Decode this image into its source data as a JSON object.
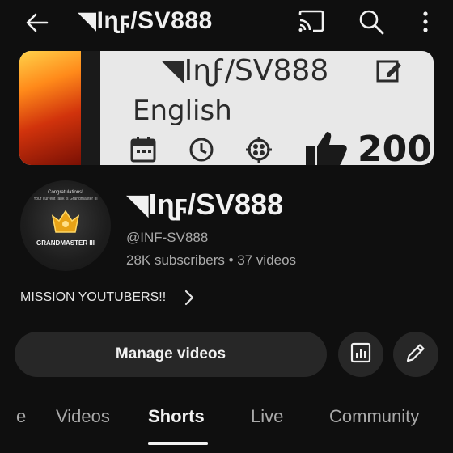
{
  "header": {
    "channel_title": "◥Iɳϝ/SV888",
    "icons": [
      "back-arrow-icon",
      "cast-icon",
      "search-icon",
      "more-vert-icon"
    ]
  },
  "banner": {
    "title": "◥Iɳϝ/SV888",
    "language": "English",
    "count": "200"
  },
  "avatar": {
    "line1": "Congratulations!",
    "line2": "Your current rank is Grandmaster III",
    "rank": "GRANDMASTER III"
  },
  "channel": {
    "name": "◥Iɳϝ/SV888",
    "handle": "@INF-SV888",
    "meta": "28K subscribers • 37 videos"
  },
  "link": {
    "text": "MISSION YOUTUBERS!!"
  },
  "actions": {
    "manage_label": "Manage videos"
  },
  "tabs": {
    "fragment": "e",
    "items": [
      "Videos",
      "Shorts",
      "Live",
      "Community"
    ],
    "active": "Shorts"
  },
  "colors": {
    "background": "#0f0f0f",
    "button": "#272727",
    "text_primary": "#f1f1f1",
    "text_secondary": "#aaaaaa"
  }
}
